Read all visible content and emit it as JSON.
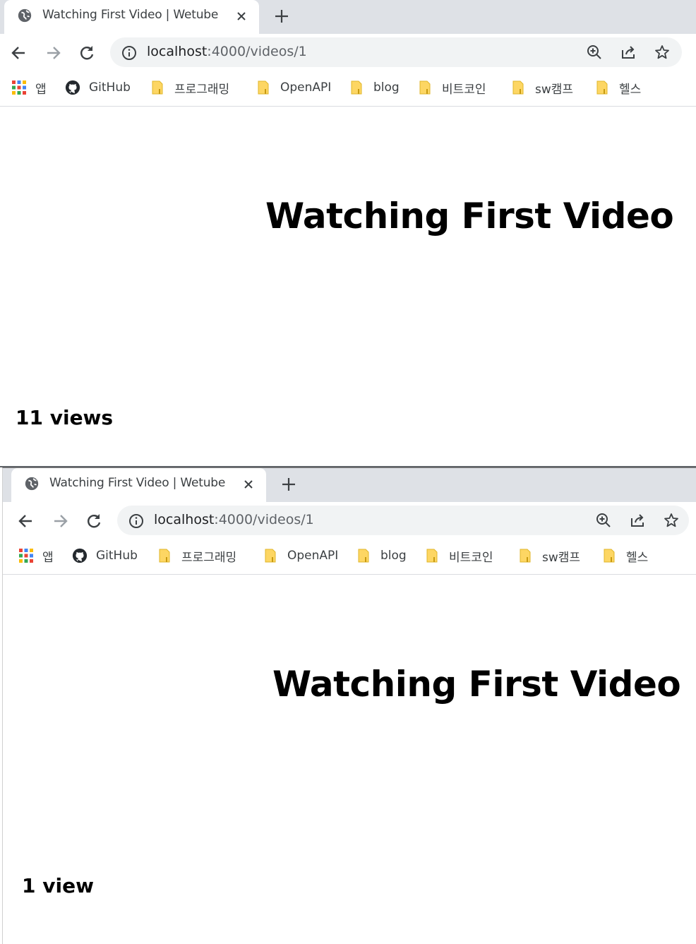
{
  "browsers": [
    {
      "tab": {
        "title": "Watching First Video | Wetube"
      },
      "address_bar": {
        "host": "localhost",
        "path": ":4000/videos/1"
      },
      "bookmarks": [
        {
          "label": "앱",
          "icon": "apps-grid-icon"
        },
        {
          "label": "GitHub",
          "icon": "github-icon"
        },
        {
          "label": "프로그래밍",
          "icon": "folder-icon"
        },
        {
          "label": "OpenAPI",
          "icon": "folder-icon"
        },
        {
          "label": "blog",
          "icon": "folder-icon"
        },
        {
          "label": "비트코인",
          "icon": "folder-icon"
        },
        {
          "label": "sw캠프",
          "icon": "folder-icon"
        },
        {
          "label": "헬스",
          "icon": "folder-icon"
        }
      ],
      "page": {
        "title": "Watching First Video",
        "views": "11 views"
      }
    },
    {
      "tab": {
        "title": "Watching First Video | Wetube"
      },
      "address_bar": {
        "host": "localhost",
        "path": ":4000/videos/1"
      },
      "bookmarks": [
        {
          "label": "앱",
          "icon": "apps-grid-icon"
        },
        {
          "label": "GitHub",
          "icon": "github-icon"
        },
        {
          "label": "프로그래밍",
          "icon": "folder-icon"
        },
        {
          "label": "OpenAPI",
          "icon": "folder-icon"
        },
        {
          "label": "blog",
          "icon": "folder-icon"
        },
        {
          "label": "비트코인",
          "icon": "folder-icon"
        },
        {
          "label": "sw캠프",
          "icon": "folder-icon"
        },
        {
          "label": "헬스",
          "icon": "folder-icon"
        }
      ],
      "page": {
        "title": "Watching First Video",
        "views": "1 view"
      }
    }
  ],
  "colors": {
    "tabstrip": "#dee1e6",
    "omnibox": "#f1f3f4",
    "folder": "#fdd663",
    "text": "#3c4043"
  }
}
